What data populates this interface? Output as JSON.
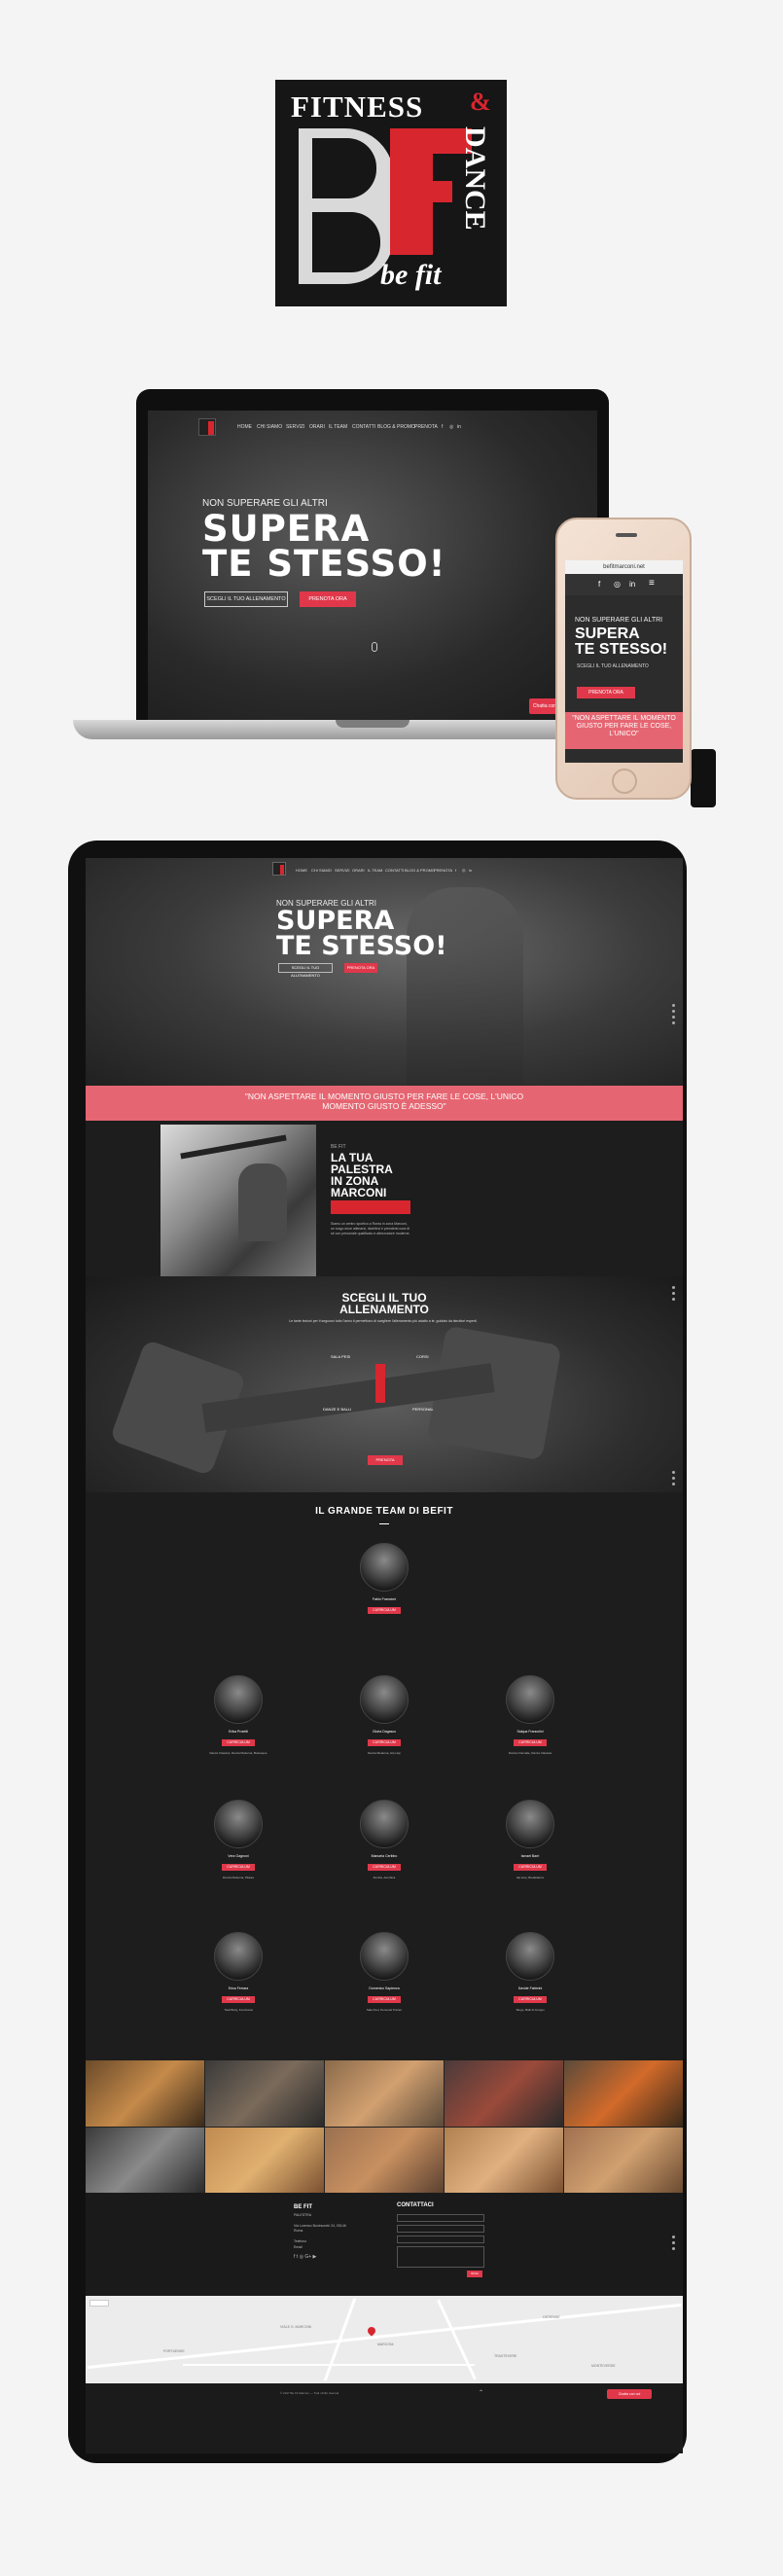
{
  "colors": {
    "accent": "#e0384a",
    "brand_red": "#d8262f",
    "quote_bg": "#e56672",
    "dark_bg": "#1d1d1d"
  },
  "logo": {
    "word_top": "FITNESS",
    "amp": "&",
    "word_side": "DANCE",
    "tagline": "be fit"
  },
  "nav": {
    "items": [
      "HOME",
      "CHI SIAMO",
      "SERVIZI",
      "ORARI",
      "IL TEAM",
      "CONTATTI",
      "BLOG & PROMO",
      "PRENOTA"
    ],
    "social_icons": [
      "facebook-icon",
      "instagram-icon",
      "linkedin-icon"
    ]
  },
  "hero": {
    "subtitle": "NON SUPERARE GLI ALTRI",
    "title_line1": "SUPERA",
    "title_line2": "TE STESSO!",
    "btn_choose": "SCEGLI IL TUO ALLENAMENTO",
    "btn_book": "PRENOTA ORA"
  },
  "phone": {
    "url": "befitmarconi.net",
    "subtitle": "NON SUPERARE GLI ALTRI",
    "title_line1": "SUPERA",
    "title_line2": "TE STESSO!",
    "btn_choose": "SCEGLI IL TUO ALLENAMENTO",
    "btn_book": "PRENOTA ORA",
    "quote": "\"NON ASPETTARE IL MOMENTO GIUSTO PER FARE LE COSE, L'UNICO\""
  },
  "quote": {
    "text": "\"NON ASPETTARE IL MOMENTO GIUSTO PER FARE LE COSE, L'UNICO MOMENTO GIUSTO È ADESSO\""
  },
  "palestra": {
    "small": "BE FIT",
    "title_l1": "LA TUA",
    "title_l2": "PALESTRA",
    "title_l3": "IN ZONA",
    "title_l4": "MARCONI",
    "text": "Siamo un centro sportivo a Roma in zona Marconi, un luogo dove allenarsi, divertirsi e prendersi cura di sé con personale qualificato e attrezzature moderne."
  },
  "allenamento": {
    "title_l1": "SCEGLI IL TUO",
    "title_l2": "ALLENAMENTO",
    "text": "Le tante lezioni per ti seguono tutto l'anno ti permettono di scegliere l'allenamento più adatto a te, guidato da istruttori esperti.",
    "items": [
      "SALA PESI",
      "CORSI",
      "DANZE E BALLI",
      "PERSONAL"
    ],
    "button": "PRENOTA"
  },
  "team": {
    "title": "IL GRANDE TEAM DI BEFIT",
    "leader": {
      "name": "Fabio Francioni",
      "button": "CURRICULUM"
    },
    "members": [
      {
        "name": "Erika Proietti",
        "button": "CURRICULUM",
        "desc": "Danza Classica, Danza Moderna, Burlesque"
      },
      {
        "name": "Gloria Dagasco",
        "button": "CURRICULUM",
        "desc": "Danza Moderna, Hip Hop"
      },
      {
        "name": "Saiqua Francolini",
        "button": "CURRICULUM",
        "desc": "Danza Orientale, Danza Classica"
      },
      {
        "name": "Vera Gagnoni",
        "button": "CURRICULUM",
        "desc": "Danza Moderna, Pilates"
      },
      {
        "name": "Manuela Ceribbo",
        "button": "CURRICULUM",
        "desc": "Zumba, Aerobica"
      },
      {
        "name": "Ismael Barri",
        "button": "CURRICULUM",
        "desc": "Hip Hop, Breakdance"
      },
      {
        "name": "Erica Ferrara",
        "button": "CURRICULUM",
        "desc": "Total Body, Functional"
      },
      {
        "name": "Domenico Sapienza",
        "button": "CURRICULUM",
        "desc": "Sala Pesi, Personal Trainer"
      },
      {
        "name": "Davide Fabbrini",
        "button": "CURRICULUM",
        "desc": "Tango, Balli di Gruppo"
      }
    ]
  },
  "footer": {
    "brand": "BE FIT",
    "brand_sub": "PALESTRA",
    "address": "Via Lorenzo Bonincontri 24, 00146 Roma",
    "phone": "Telefono",
    "email": "Email",
    "contact_title": "CONTATTACI",
    "send": "INVIA"
  },
  "map": {
    "labels": [
      "MARCONI",
      "VIALE G. MARCONI",
      "OSTIENSE",
      "TRASTEVERE",
      "PORTUENSE",
      "MONTEVERDE"
    ]
  },
  "bottom": {
    "copyright": "© 2017 Be Fit Marconi — Tutti i diritti riservati",
    "chat": "Chatta con noi"
  }
}
